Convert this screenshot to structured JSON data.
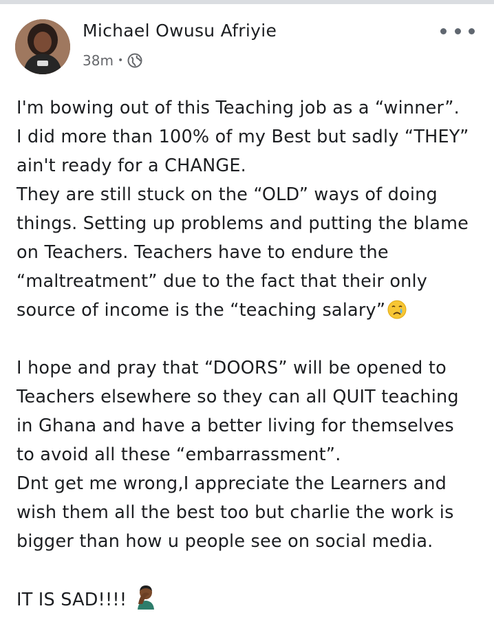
{
  "author": {
    "name": "Michael Owusu Afriyie",
    "timestamp": "38m",
    "separator": "•",
    "audience_icon": "globe-icon"
  },
  "menu_icon": "more-horizontal-icon",
  "post": {
    "lines": [
      "I'm bowing out of this Teaching job as a “winner”.",
      "I did more than 100% of my Best but sadly “THEY”",
      "ain't ready for a CHANGE.",
      "They are still stuck on the “OLD” ways of doing",
      "things. Setting up problems and putting the blame",
      "on Teachers. Teachers have to endure the",
      "“maltreatment” due to the fact that their only",
      "source of income is the “teaching salary”",
      "",
      "I hope and pray that “DOORS” will be opened to",
      "Teachers elsewhere so they can all QUIT teaching",
      "in Ghana and have a better living for themselves",
      "to avoid all these “embarrassment”.",
      "Dnt get me wrong,I appreciate the Learners and",
      "wish them all the best too but charlie the work is",
      "bigger than how u people see on social media.",
      "",
      "IT IS SAD!!!!"
    ],
    "emojis": {
      "crying_face": "crying-face-icon",
      "facepalm": "person-facepalming-icon"
    }
  },
  "colors": {
    "text": "#1c1e21",
    "secondary": "#65676b",
    "border": "#dadde1"
  }
}
